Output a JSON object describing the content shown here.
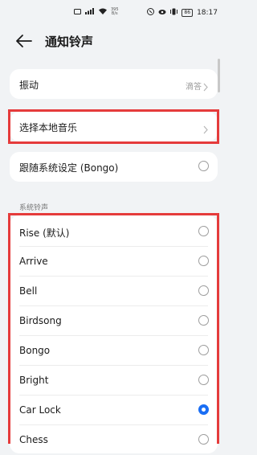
{
  "status": {
    "speed_value": "395",
    "speed_unit": "B/s",
    "battery": "86",
    "time": "18:17"
  },
  "header": {
    "title": "通知铃声"
  },
  "top_card": {
    "vibration": {
      "label": "振动",
      "value": "滴答"
    }
  },
  "local_music": {
    "label": "选择本地音乐"
  },
  "follow_system": {
    "label": "跟随系统设定 (Bongo)",
    "checked": false
  },
  "ringtones": {
    "section_title": "系统铃声",
    "selected": "Car Lock",
    "items": [
      {
        "label": "Rise (默认)"
      },
      {
        "label": "Arrive"
      },
      {
        "label": "Bell"
      },
      {
        "label": "Birdsong"
      },
      {
        "label": "Bongo"
      },
      {
        "label": "Bright"
      },
      {
        "label": "Car Lock"
      },
      {
        "label": "Chess"
      }
    ]
  },
  "colors": {
    "accent": "#1a6ef4",
    "highlight": "#e53b3b",
    "background": "#f1f3f5"
  }
}
